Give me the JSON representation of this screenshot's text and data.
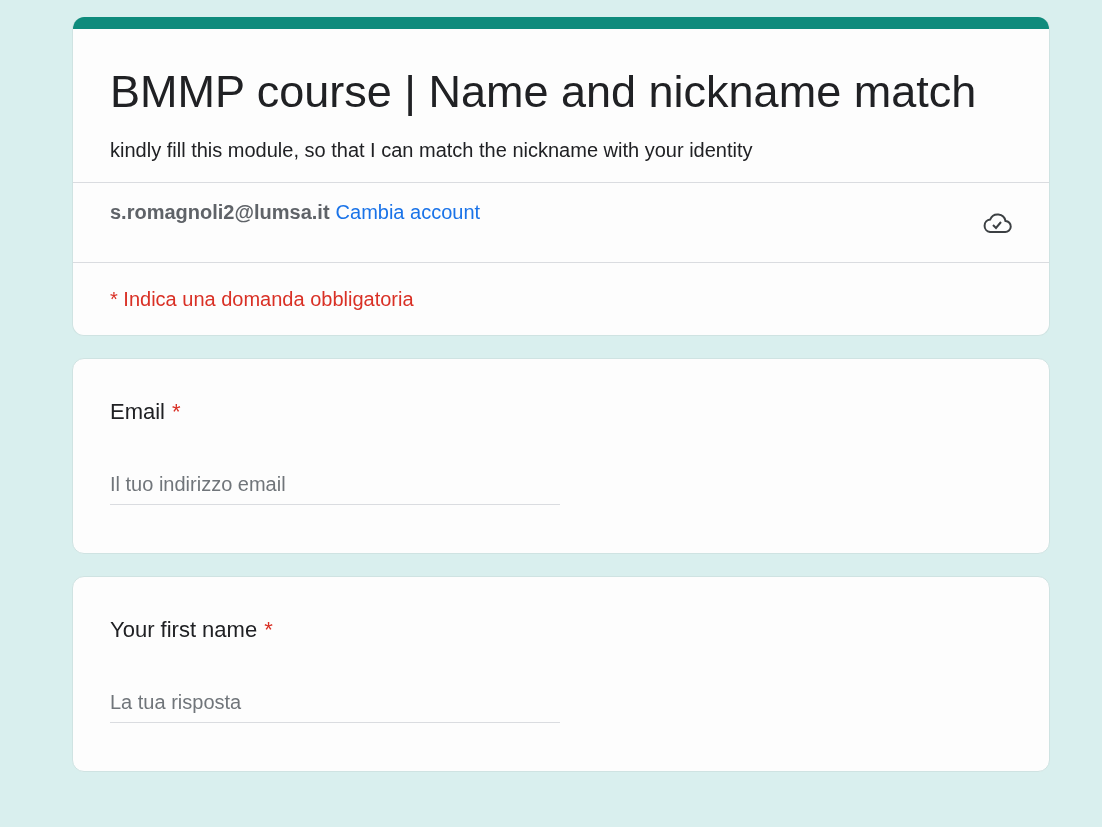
{
  "form": {
    "title": "BMMP course | Name and nickname match",
    "description": "kindly fill this module, so that I can match the nickname with your identity",
    "account": {
      "email": "s.romagnoli2@lumsa.it",
      "switch_link": "Cambia account"
    },
    "required_notice": "* Indica una domanda obbligatoria"
  },
  "questions": [
    {
      "label": "Email",
      "required_mark": "*",
      "placeholder": "Il tuo indirizzo email"
    },
    {
      "label": "Your first name",
      "required_mark": "*",
      "placeholder": "La tua risposta"
    }
  ]
}
